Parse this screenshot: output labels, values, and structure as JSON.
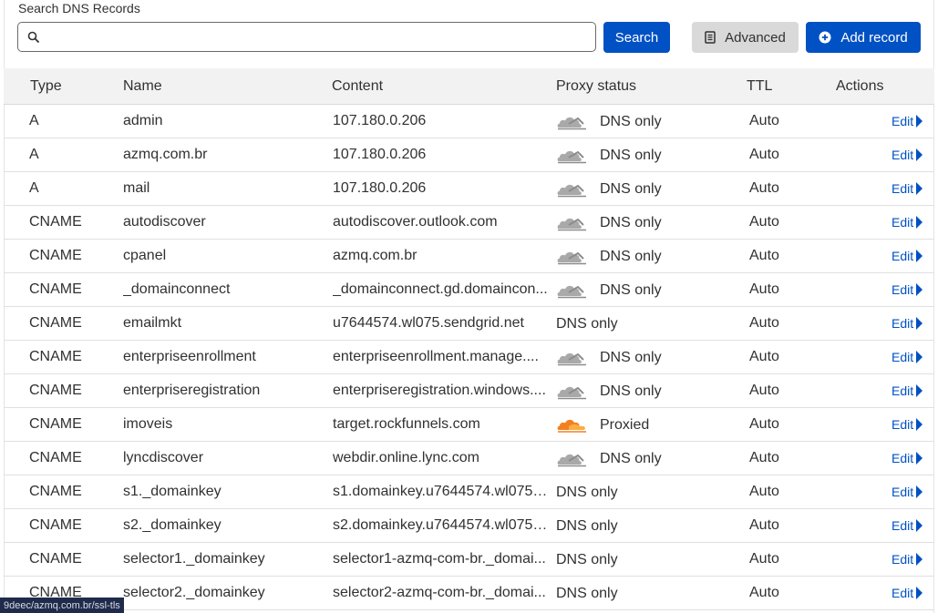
{
  "search": {
    "label": "Search DNS Records",
    "value": "",
    "placeholder": "",
    "search_button": "Search",
    "advanced_button": "Advanced",
    "add_button": "Add record"
  },
  "table": {
    "headers": {
      "type": "Type",
      "name": "Name",
      "content": "Content",
      "proxy": "Proxy status",
      "ttl": "TTL",
      "actions": "Actions"
    },
    "edit_label": "Edit",
    "rows": [
      {
        "type": "A",
        "name": "admin",
        "content": "107.180.0.206",
        "proxy": "DNS only",
        "proxy_icon": "cloud-grey",
        "ttl": "Auto"
      },
      {
        "type": "A",
        "name": "azmq.com.br",
        "content": "107.180.0.206",
        "proxy": "DNS only",
        "proxy_icon": "cloud-grey",
        "ttl": "Auto"
      },
      {
        "type": "A",
        "name": "mail",
        "content": "107.180.0.206",
        "proxy": "DNS only",
        "proxy_icon": "cloud-grey",
        "ttl": "Auto"
      },
      {
        "type": "CNAME",
        "name": "autodiscover",
        "content": "autodiscover.outlook.com",
        "proxy": "DNS only",
        "proxy_icon": "cloud-grey",
        "ttl": "Auto"
      },
      {
        "type": "CNAME",
        "name": "cpanel",
        "content": "azmq.com.br",
        "proxy": "DNS only",
        "proxy_icon": "cloud-grey",
        "ttl": "Auto"
      },
      {
        "type": "CNAME",
        "name": "_domainconnect",
        "content": "_domainconnect.gd.domaincon...",
        "proxy": "DNS only",
        "proxy_icon": "cloud-grey",
        "ttl": "Auto"
      },
      {
        "type": "CNAME",
        "name": "emailmkt",
        "content": "u7644574.wl075.sendgrid.net",
        "proxy": "DNS only",
        "proxy_icon": "none",
        "ttl": "Auto"
      },
      {
        "type": "CNAME",
        "name": "enterpriseenrollment",
        "content": "enterpriseenrollment.manage....",
        "proxy": "DNS only",
        "proxy_icon": "cloud-grey",
        "ttl": "Auto"
      },
      {
        "type": "CNAME",
        "name": "enterpriseregistration",
        "content": "enterpriseregistration.windows....",
        "proxy": "DNS only",
        "proxy_icon": "cloud-grey",
        "ttl": "Auto"
      },
      {
        "type": "CNAME",
        "name": "imoveis",
        "content": "target.rockfunnels.com",
        "proxy": "Proxied",
        "proxy_icon": "cloud-orange",
        "ttl": "Auto"
      },
      {
        "type": "CNAME",
        "name": "lyncdiscover",
        "content": "webdir.online.lync.com",
        "proxy": "DNS only",
        "proxy_icon": "cloud-grey",
        "ttl": "Auto"
      },
      {
        "type": "CNAME",
        "name": "s1._domainkey",
        "content": "s1.domainkey.u7644574.wl075.s...",
        "proxy": "DNS only",
        "proxy_icon": "none",
        "ttl": "Auto"
      },
      {
        "type": "CNAME",
        "name": "s2._domainkey",
        "content": "s2.domainkey.u7644574.wl075.s...",
        "proxy": "DNS only",
        "proxy_icon": "none",
        "ttl": "Auto"
      },
      {
        "type": "CNAME",
        "name": "selector1._domainkey",
        "content": "selector1-azmq-com-br._domai...",
        "proxy": "DNS only",
        "proxy_icon": "none",
        "ttl": "Auto"
      },
      {
        "type": "CNAME",
        "name": "selector2._domainkey",
        "content": "selector2-azmq-com-br._domai...",
        "proxy": "DNS only",
        "proxy_icon": "none",
        "ttl": "Auto"
      }
    ]
  },
  "status_bar": {
    "text": "9deec/azmq.com.br/ssl-tls"
  },
  "colors": {
    "accent": "#0051c3",
    "proxied": "#f38020",
    "dns_only_cloud": "#9a9a9a"
  }
}
